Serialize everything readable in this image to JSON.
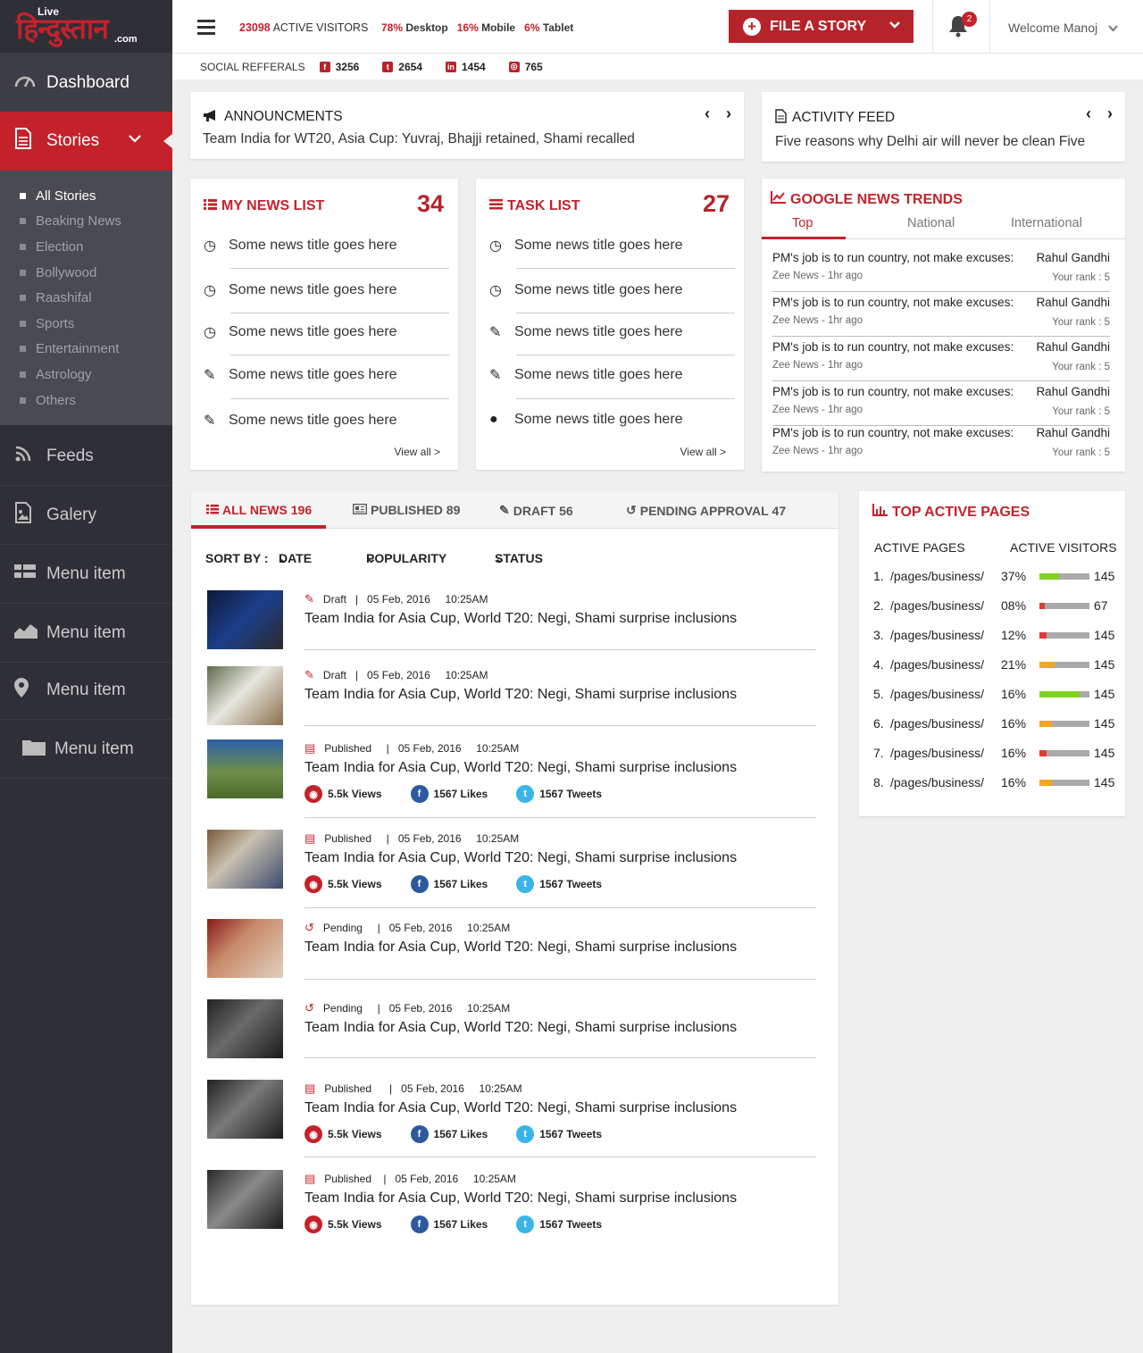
{
  "brand": {
    "small": "Live",
    "main": "हिन्दुस्तान",
    "suffix": ".com"
  },
  "sidebar": {
    "dashboard": "Dashboard",
    "stories": "Stories",
    "subitems": [
      "All Stories",
      "Beaking News",
      "Election",
      "Bollywood",
      "Raashifal",
      "Sports",
      "Entertainment",
      "Astrology",
      "Others"
    ],
    "feeds": "Feeds",
    "galery": "Galery",
    "menu1": "Menu item",
    "menu2": "Menu item",
    "menu3": "Menu item",
    "menu4": "Menu item"
  },
  "topbar": {
    "active_count": "23098",
    "active_label": "ACTIVE VISITORS",
    "desktop_pct": "78%",
    "desktop_label": "Desktop",
    "mobile_pct": "16%",
    "mobile_label": "Mobile",
    "tablet_pct": "6%",
    "tablet_label": "Tablet",
    "file_story": "FILE A STORY",
    "notif_count": "2",
    "welcome": "Welcome Manoj"
  },
  "social": {
    "label": "SOCIAL REFFERALS",
    "facebook": "3256",
    "twitter": "2654",
    "linkedin": "1454",
    "instagram": "765"
  },
  "announcements": {
    "title": "ANNOUNCMENTS",
    "text": "Team India for WT20, Asia Cup: Yuvraj, Bhajji retained, Shami recalled"
  },
  "activity": {
    "title": "ACTIVITY FEED",
    "text": "Five reasons why Delhi air will never be clean Five"
  },
  "my_news": {
    "title": "MY NEWS LIST",
    "count": "34",
    "items": [
      "Some news title goes here",
      "Some news title goes here",
      "Some news title goes here",
      "Some news title goes here",
      "Some news title goes here"
    ],
    "view_all": "View all >"
  },
  "task_list": {
    "title": "TASK LIST",
    "count": "27",
    "items": [
      "Some news title goes here",
      "Some news title goes here",
      "Some news title goes here",
      "Some news title goes here",
      "Some news title goes here"
    ],
    "view_all": "View all >"
  },
  "trends": {
    "title": "GOOGLE NEWS TRENDS",
    "tabs": [
      "Top",
      "National",
      "International"
    ],
    "items": [
      {
        "title": "PM's job is to run country, not make excuses:",
        "person": "Rahul Gandhi",
        "source": "Zee News - 1hr ago",
        "rank": "Your rank : 5"
      },
      {
        "title": "PM's job is to run country, not make excuses:",
        "person": "Rahul Gandhi",
        "source": "Zee News - 1hr ago",
        "rank": "Your rank : 5"
      },
      {
        "title": "PM's job is to run country, not make excuses:",
        "person": "Rahul Gandhi",
        "source": "Zee News - 1hr ago",
        "rank": "Your rank : 5"
      },
      {
        "title": "PM's job is to run country, not make excuses:",
        "person": "Rahul Gandhi",
        "source": "Zee News - 1hr ago",
        "rank": "Your rank : 5"
      },
      {
        "title": "PM's job is to run country, not make excuses:",
        "person": "Rahul Gandhi",
        "source": "Zee News - 1hr ago",
        "rank": "Your rank : 5"
      }
    ]
  },
  "news": {
    "tabs": [
      {
        "label": "ALL NEWS",
        "count": "196"
      },
      {
        "label": "PUBLISHED",
        "count": "89"
      },
      {
        "label": "DRAFT",
        "count": "56"
      },
      {
        "label": "PENDING APPROVAL",
        "count": "47"
      }
    ],
    "sort_label": "SORT BY :",
    "sort_date": "DATE",
    "sort_popularity": "POPULARITY",
    "sort_status": "STATUS",
    "stories": [
      {
        "status": "Draft",
        "date": "05 Feb, 2016",
        "time": "10:25AM",
        "title": "Team India for Asia Cup, World T20: Negi, Shami surprise inclusions"
      },
      {
        "status": "Draft",
        "date": "05 Feb, 2016",
        "time": "10:25AM",
        "title": "Team India for Asia Cup, World T20: Negi, Shami surprise inclusions"
      },
      {
        "status": "Published",
        "date": "05 Feb, 2016",
        "time": "10:25AM",
        "title": "Team India for Asia Cup, World T20: Negi, Shami surprise inclusions",
        "views": "5.5k Views",
        "likes": "1567 Likes",
        "tweets": "1567  Tweets"
      },
      {
        "status": "Published",
        "date": "05 Feb, 2016",
        "time": "10:25AM",
        "title": "Team India for Asia Cup, World T20: Negi, Shami surprise inclusions",
        "views": "5.5k Views",
        "likes": "1567 Likes",
        "tweets": "1567  Tweets"
      },
      {
        "status": "Pending",
        "date": "05 Feb, 2016",
        "time": "10:25AM",
        "title": "Team India for Asia Cup, World T20: Negi, Shami surprise inclusions"
      },
      {
        "status": "Pending",
        "date": "05 Feb, 2016",
        "time": "10:25AM",
        "title": "Team India for Asia Cup, World T20: Negi, Shami surprise inclusions"
      },
      {
        "status": "Published",
        "date": "05 Feb, 2016",
        "time": "10:25AM",
        "title": "Team India for Asia Cup, World T20: Negi, Shami surprise inclusions",
        "views": "5.5k Views",
        "likes": "1567 Likes",
        "tweets": "1567  Tweets"
      },
      {
        "status": "Published",
        "date": "05 Feb, 2016",
        "time": "10:25AM",
        "title": "Team India for Asia Cup, World T20: Negi, Shami surprise inclusions",
        "views": "5.5k Views",
        "likes": "1567 Likes",
        "tweets": "1567  Tweets"
      }
    ]
  },
  "top_pages": {
    "title": "TOP ACTIVE PAGES",
    "col1": "ACTIVE PAGES",
    "col2": "ACTIVE VISITORS",
    "rows": [
      {
        "num": "1.",
        "path": "/pages/business/",
        "pct": "37%",
        "fill": 0.4,
        "color": "#7ed321",
        "visitors": "145"
      },
      {
        "num": "2.",
        "path": "/pages/business/",
        "pct": "08%",
        "fill": 0.1,
        "color": "#e53935",
        "visitors": "67"
      },
      {
        "num": "3.",
        "path": "/pages/business/",
        "pct": "12%",
        "fill": 0.15,
        "color": "#e53935",
        "visitors": "145"
      },
      {
        "num": "4.",
        "path": "/pages/business/",
        "pct": "21%",
        "fill": 0.3,
        "color": "#f5a623",
        "visitors": "145"
      },
      {
        "num": "5.",
        "path": "/pages/business/",
        "pct": "16%",
        "fill": 0.8,
        "color": "#7ed321",
        "visitors": "145"
      },
      {
        "num": "6.",
        "path": "/pages/business/",
        "pct": "16%",
        "fill": 0.25,
        "color": "#f5a623",
        "visitors": "145"
      },
      {
        "num": "7.",
        "path": "/pages/business/",
        "pct": "16%",
        "fill": 0.15,
        "color": "#e53935",
        "visitors": "145"
      },
      {
        "num": "8.",
        "path": "/pages/business/",
        "pct": "16%",
        "fill": 0.25,
        "color": "#f5a623",
        "visitors": "145"
      }
    ]
  }
}
